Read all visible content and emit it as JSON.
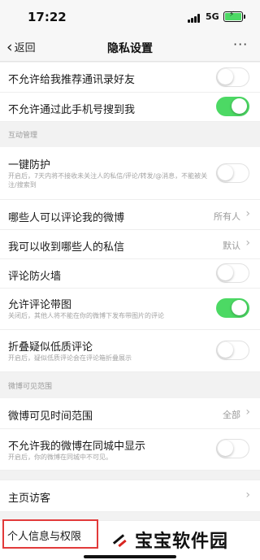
{
  "status_bar": {
    "time": "17:22",
    "network": "5G"
  },
  "nav": {
    "back_label": "返回",
    "title": "隐私设置",
    "more_label": "···"
  },
  "rows": [
    {
      "label": "不允许给我推荐通讯录好友",
      "toggle": false
    },
    {
      "label": "不允许通过此手机号搜到我",
      "toggle": true
    }
  ],
  "section_interaction": {
    "header": "互动管理"
  },
  "interaction_rows": [
    {
      "label": "一键防护",
      "desc": "开启后，7天内将不接收未关注人的私信/评论/转发/@消息，不能被关注/搜索到",
      "toggle": false
    },
    {
      "label": "哪些人可以评论我的微博",
      "value": "所有人"
    },
    {
      "label": "我可以收到哪些人的私信",
      "value": "默认"
    },
    {
      "label": "评论防火墙",
      "toggle": false
    },
    {
      "label": "允许评论带图",
      "desc": "关闭后，其他人将不能在你的微博下发布带图片的评论",
      "toggle": true
    },
    {
      "label": "折叠疑似低质评论",
      "desc": "开启后，疑似低质评论会在评论箱折叠展示",
      "toggle": false
    }
  ],
  "section_visibility": {
    "header": "微博可见范围"
  },
  "visibility_rows": [
    {
      "label": "微博可见时间范围",
      "value": "全部"
    },
    {
      "label": "不允许我的微博在同城中显示",
      "desc": "开启后，你的微博在同城中不可见。",
      "toggle": false
    }
  ],
  "visitor_row": {
    "label": "主页访客"
  },
  "personal_row": {
    "label": "个人信息与权限"
  },
  "watermark": {
    "text": "宝宝软件园"
  },
  "colors": {
    "toggle_on": "#4cd964",
    "highlight": "#e23a3a",
    "watermark_red": "#d8241f"
  }
}
